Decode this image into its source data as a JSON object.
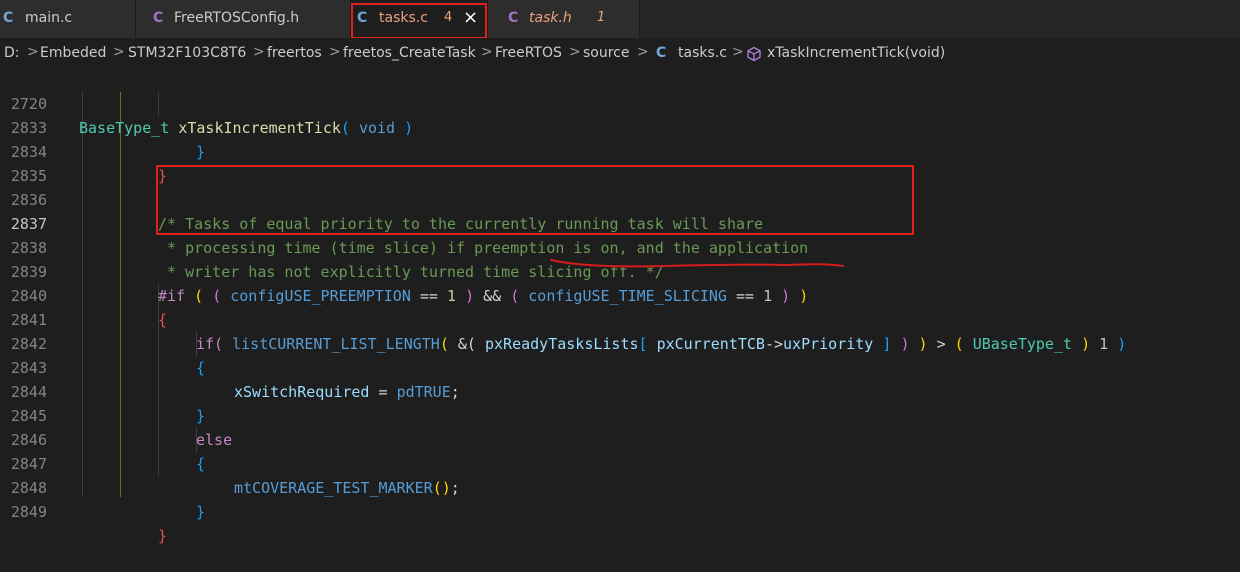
{
  "tabs": [
    {
      "icon": "C",
      "name": "main.c",
      "badge": ""
    },
    {
      "icon": "C",
      "name": "FreeRTOSConfig.h",
      "badge": ""
    },
    {
      "icon": "C",
      "name": "tasks.c",
      "badge": "4",
      "close": "×"
    },
    {
      "icon": "C",
      "name": "task.h",
      "badge": "1"
    }
  ],
  "breadcrumb": {
    "items": [
      "D:",
      "Embeded",
      "STM32F103C8T6",
      "freertos",
      "freetos_CreateTask",
      "FreeRTOS",
      "source",
      "tasks.c",
      "xTaskIncrementTick(void)"
    ],
    "file_icon": "C",
    "sep": ">"
  },
  "sticky": {
    "line": "2720",
    "t1": "BaseType_t",
    "t2": "xTaskIncrementTick",
    "t3": "(",
    "t4": "void",
    "t5": ")"
  },
  "lines": [
    {
      "n": "2833"
    },
    {
      "n": "2834"
    },
    {
      "n": "2835"
    },
    {
      "n": "2836"
    },
    {
      "n": "2837"
    },
    {
      "n": "2838"
    },
    {
      "n": "2839"
    },
    {
      "n": "2840"
    },
    {
      "n": "2841"
    },
    {
      "n": "2842"
    },
    {
      "n": "2843"
    },
    {
      "n": "2844"
    },
    {
      "n": "2845"
    },
    {
      "n": "2846"
    },
    {
      "n": "2847"
    },
    {
      "n": "2848"
    },
    {
      "n": "2849"
    }
  ],
  "code": {
    "close": "}",
    "open": "{",
    "c1": "/* Tasks of equal priority to the currently running task will share",
    "c2": " * processing time (time slice) if preemption is on, and the application",
    "c3": " * writer has not explicitly turned time slicing off. */",
    "if_dir": "#if",
    "p_open": "(",
    "p_close": ")",
    "preempt": "configUSE_PREEMPTION",
    "eq": "==",
    "one": "1",
    "and": "&&",
    "slicing": "configUSE_TIME_SLICING",
    "if_kw": "if(",
    "list_len": "listCURRENT_LIST_LENGTH",
    "amp": "&(",
    "ready": "pxReadyTasksLists",
    "sq_open": "[",
    "sq_close": "]",
    "tcb": "pxCurrentTCB",
    "arrow": "->",
    "prio": "uxPriority",
    "gt": ">",
    "ubase": "UBaseType_t",
    "xswitch": "xSwitchRequired",
    "assign": "=",
    "pdtrue": "pdTRUE",
    "semi": ";",
    "else_kw": "else",
    "marker": "mtCOVERAGE_TEST_MARKER",
    "call": "()"
  },
  "colors": {
    "accent_box": "#e02020",
    "underline": "#d41c1c"
  }
}
